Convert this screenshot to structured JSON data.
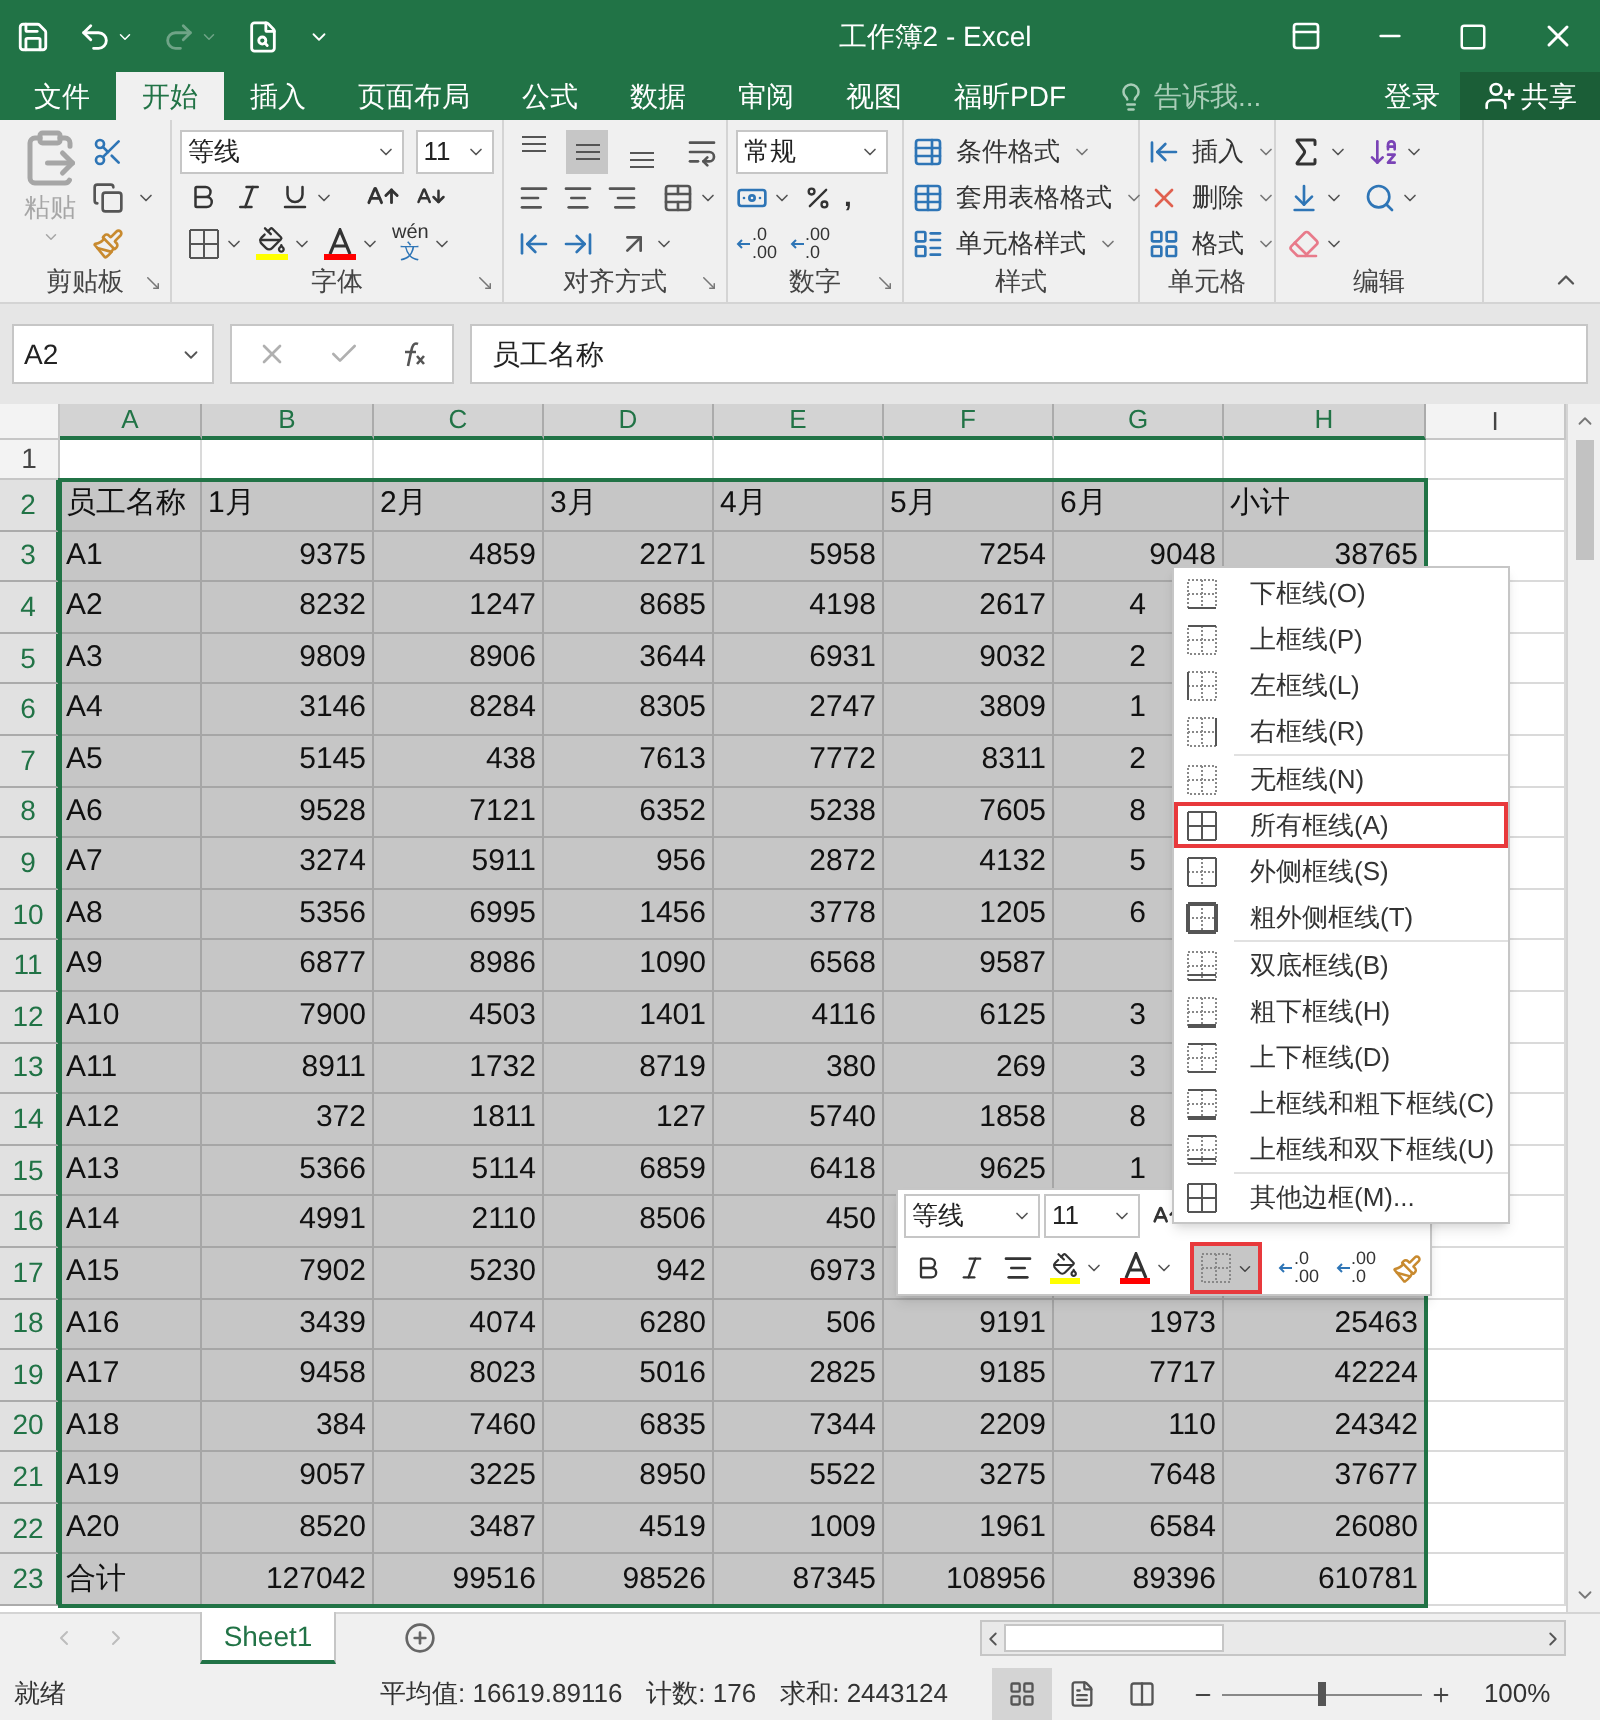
{
  "title_bar": {
    "title": "工作簿2 - Excel",
    "quick_access": [
      {
        "kind": "save",
        "disabled": false
      },
      {
        "kind": "undo",
        "disabled": false
      },
      {
        "kind": "redo",
        "disabled": true
      },
      {
        "kind": "preview",
        "disabled": false
      }
    ]
  },
  "tabs": [
    {
      "label": "文件",
      "selected": false
    },
    {
      "label": "开始",
      "selected": true
    },
    {
      "label": "插入",
      "selected": false
    },
    {
      "label": "页面布局",
      "selected": false
    },
    {
      "label": "公式",
      "selected": false
    },
    {
      "label": "数据",
      "selected": false
    },
    {
      "label": "审阅",
      "selected": false
    },
    {
      "label": "视图",
      "selected": false
    },
    {
      "label": "福昕PDF",
      "selected": false
    }
  ],
  "tell_me": {
    "placeholder": "告诉我..."
  },
  "account": {
    "sign_in": "登录",
    "share": "共享"
  },
  "ribbon": {
    "clipboard": {
      "label": "剪贴板",
      "paste": {
        "label": "粘贴",
        "disabled": true
      }
    },
    "font": {
      "label": "字体",
      "font_name": "等线",
      "font_size": "11",
      "phonetic": {
        "top": "wén",
        "bottom": "文"
      }
    },
    "alignment": {
      "label": "对齐方式",
      "vertical": [
        {
          "kind": "top",
          "selected": false
        },
        {
          "kind": "middle",
          "selected": true
        },
        {
          "kind": "bottom",
          "selected": false
        }
      ]
    },
    "number": {
      "label": "数字",
      "format": "常规",
      "comma": ",",
      "decimal_buttons": [
        {
          "top": ".0",
          "bottom": ".00"
        },
        {
          "top": ".00",
          "bottom": ".0"
        }
      ]
    },
    "styles": {
      "label": "样式",
      "commands": [
        "条件格式",
        "套用表格格式",
        "单元格样式"
      ]
    },
    "cells": {
      "label": "单元格",
      "commands": [
        "插入",
        "删除",
        "格式"
      ]
    },
    "editing": {
      "label": "编辑"
    }
  },
  "formula_bar": {
    "name_box": "A2",
    "content": "员工名称"
  },
  "sheet": {
    "columns": [
      {
        "label": "A",
        "selected": true
      },
      {
        "label": "B",
        "selected": true
      },
      {
        "label": "C",
        "selected": true
      },
      {
        "label": "D",
        "selected": true
      },
      {
        "label": "E",
        "selected": true
      },
      {
        "label": "F",
        "selected": true
      },
      {
        "label": "G",
        "selected": true
      },
      {
        "label": "H",
        "selected": true
      },
      {
        "label": "I",
        "selected": false
      }
    ],
    "rows": [
      {
        "number": "1",
        "kind": "blank",
        "selected": false,
        "cells": []
      },
      {
        "number": "2",
        "kind": "header",
        "selected": true,
        "cells": [
          "员工名称",
          "1月",
          "2月",
          "3月",
          "4月",
          "5月",
          "6月",
          "小计"
        ]
      },
      {
        "number": "3",
        "kind": "data",
        "selected": true,
        "cells": [
          "A1",
          "9375",
          "4859",
          "2271",
          "5958",
          "7254",
          "9048",
          "38765"
        ]
      },
      {
        "number": "4",
        "kind": "data",
        "selected": true,
        "cells": [
          "A2",
          "8232",
          "1247",
          "8685",
          "4198",
          "2617",
          "4"
        ]
      },
      {
        "number": "5",
        "kind": "data",
        "selected": true,
        "cells": [
          "A3",
          "9809",
          "8906",
          "3644",
          "6931",
          "9032",
          "2"
        ]
      },
      {
        "number": "6",
        "kind": "data",
        "selected": true,
        "cells": [
          "A4",
          "3146",
          "8284",
          "8305",
          "2747",
          "3809",
          "1"
        ]
      },
      {
        "number": "7",
        "kind": "data",
        "selected": true,
        "cells": [
          "A5",
          "5145",
          "438",
          "7613",
          "7772",
          "8311",
          "2"
        ]
      },
      {
        "number": "8",
        "kind": "data",
        "selected": true,
        "cells": [
          "A6",
          "9528",
          "7121",
          "6352",
          "5238",
          "7605",
          "8"
        ]
      },
      {
        "number": "9",
        "kind": "data",
        "selected": true,
        "cells": [
          "A7",
          "3274",
          "5911",
          "956",
          "2872",
          "4132",
          "5"
        ]
      },
      {
        "number": "10",
        "kind": "data",
        "selected": true,
        "cells": [
          "A8",
          "5356",
          "6995",
          "1456",
          "3778",
          "1205",
          "6"
        ]
      },
      {
        "number": "11",
        "kind": "data",
        "selected": true,
        "cells": [
          "A9",
          "6877",
          "8986",
          "1090",
          "6568",
          "9587"
        ]
      },
      {
        "number": "12",
        "kind": "data",
        "selected": true,
        "cells": [
          "A10",
          "7900",
          "4503",
          "1401",
          "4116",
          "6125",
          "3"
        ]
      },
      {
        "number": "13",
        "kind": "data",
        "selected": true,
        "cells": [
          "A11",
          "8911",
          "1732",
          "8719",
          "380",
          "269",
          "3"
        ]
      },
      {
        "number": "14",
        "kind": "data",
        "selected": true,
        "cells": [
          "A12",
          "372",
          "1811",
          "127",
          "5740",
          "1858",
          "8"
        ]
      },
      {
        "number": "15",
        "kind": "data",
        "selected": true,
        "cells": [
          "A13",
          "5366",
          "5114",
          "6859",
          "6418",
          "9625",
          "1"
        ]
      },
      {
        "number": "16",
        "kind": "data",
        "selected": true,
        "cells": [
          "A14",
          "4991",
          "2110",
          "8506",
          "450"
        ]
      },
      {
        "number": "17",
        "kind": "data",
        "selected": true,
        "cells": [
          "A15",
          "7902",
          "5230",
          "942",
          "6973"
        ]
      },
      {
        "number": "18",
        "kind": "data",
        "selected": true,
        "cells": [
          "A16",
          "3439",
          "4074",
          "6280",
          "506",
          "9191",
          "1973",
          "25463"
        ]
      },
      {
        "number": "19",
        "kind": "data",
        "selected": true,
        "cells": [
          "A17",
          "9458",
          "8023",
          "5016",
          "2825",
          "9185",
          "7717",
          "42224"
        ]
      },
      {
        "number": "20",
        "kind": "data",
        "selected": true,
        "cells": [
          "A18",
          "384",
          "7460",
          "6835",
          "7344",
          "2209",
          "110",
          "24342"
        ]
      },
      {
        "number": "21",
        "kind": "data",
        "selected": true,
        "cells": [
          "A19",
          "9057",
          "3225",
          "8950",
          "5522",
          "3275",
          "7648",
          "37677"
        ]
      },
      {
        "number": "22",
        "kind": "data",
        "selected": true,
        "cells": [
          "A20",
          "8520",
          "3487",
          "4519",
          "1009",
          "1961",
          "6584",
          "26080"
        ]
      },
      {
        "number": "23",
        "kind": "data",
        "selected": true,
        "cells": [
          "合计",
          "127042",
          "99516",
          "98526",
          "87345",
          "108956",
          "89396",
          "610781"
        ]
      }
    ]
  },
  "border_menu": {
    "sections": [
      [
        {
          "label": "下框线(O)",
          "kind": "bottom",
          "annotated": false
        },
        {
          "label": "上框线(P)",
          "kind": "top",
          "annotated": false
        },
        {
          "label": "左框线(L)",
          "kind": "left",
          "annotated": false
        },
        {
          "label": "右框线(R)",
          "kind": "right",
          "annotated": false
        }
      ],
      [
        {
          "label": "无框线(N)",
          "kind": "none",
          "annotated": false
        },
        {
          "label": "所有框线(A)",
          "kind": "all",
          "annotated": true
        },
        {
          "label": "外侧框线(S)",
          "kind": "outside",
          "annotated": false
        },
        {
          "label": "粗外侧框线(T)",
          "kind": "thick-outside",
          "annotated": false
        }
      ],
      [
        {
          "label": "双底框线(B)",
          "kind": "double-bottom",
          "annotated": false
        },
        {
          "label": "粗下框线(H)",
          "kind": "thick-bottom",
          "annotated": false
        },
        {
          "label": "上下框线(D)",
          "kind": "top-bottom",
          "annotated": false
        },
        {
          "label": "上框线和粗下框线(C)",
          "kind": "top-thick-bottom",
          "annotated": false
        },
        {
          "label": "上框线和双下框线(U)",
          "kind": "top-double-bottom",
          "annotated": false
        }
      ],
      [
        {
          "label": "其他边框(M)...",
          "kind": "all",
          "annotated": false
        }
      ]
    ]
  },
  "mini_toolbar": {
    "font_name": "等线",
    "font_size": "11",
    "border_button": {
      "expanded": true,
      "annotated": true
    },
    "decimal_buttons": [
      {
        "top": ".0",
        "bottom": ".00"
      },
      {
        "top": ".00",
        "bottom": ".0"
      }
    ]
  },
  "sheet_tabs": [
    {
      "label": "Sheet1",
      "selected": true
    }
  ],
  "status_bar": {
    "status": "就绪",
    "average": "平均值: 16619.89116",
    "count": "计数: 176",
    "sum": "求和: 2443124",
    "views": [
      {
        "kind": "normal",
        "selected": true
      },
      {
        "kind": "layout",
        "selected": false
      },
      {
        "kind": "break",
        "selected": false
      }
    ],
    "zoom_slider": {
      "level": 0.5
    },
    "zoom": "100%"
  }
}
